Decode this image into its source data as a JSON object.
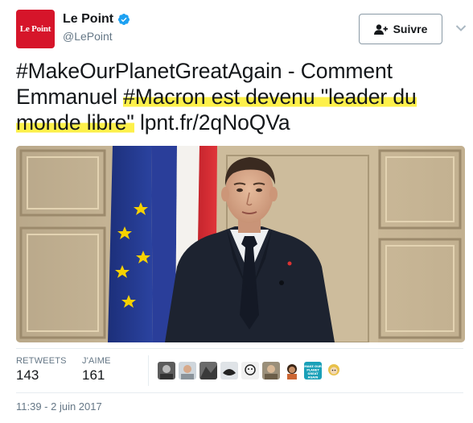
{
  "account": {
    "avatar_text": "Le Point",
    "display_name": "Le Point",
    "handle": "@LePoint",
    "verified": true,
    "avatar_color": "#d6152a"
  },
  "follow": {
    "label": "Suivre"
  },
  "tweet": {
    "parts": [
      {
        "text": "#MakeOurPlanetGreatAgain",
        "type": "hashtag",
        "highlight": false
      },
      {
        "text": " - Comment Emmanuel ",
        "type": "text",
        "highlight": false
      },
      {
        "text": "#Macron est devenu \"leader du monde libre\"",
        "type": "hashtag",
        "highlight": true
      },
      {
        "text": " ",
        "type": "text",
        "highlight": false
      },
      {
        "text": "lpnt.fr/2qNoQVa",
        "type": "link",
        "highlight": false
      }
    ],
    "highlight_color": "#fdf04a"
  },
  "stats": {
    "retweets_label": "RETWEETS",
    "retweets_value": "143",
    "likes_label": "J'AIME",
    "likes_value": "161",
    "liker_avatars": [
      "liker-avatar-1",
      "liker-avatar-2",
      "liker-avatar-3",
      "liker-avatar-4",
      "liker-avatar-5",
      "liker-avatar-6",
      "liker-avatar-7",
      "liker-avatar-8",
      "liker-avatar-9"
    ],
    "badge_text": "MAKE OUR PLANET GREAT AGAIN"
  },
  "timestamp": "11:39 - 2 juin 2017",
  "colors": {
    "text": "#14171a",
    "secondary": "#657786",
    "verified": "#1da1f2",
    "border": "#e6ecf0"
  }
}
